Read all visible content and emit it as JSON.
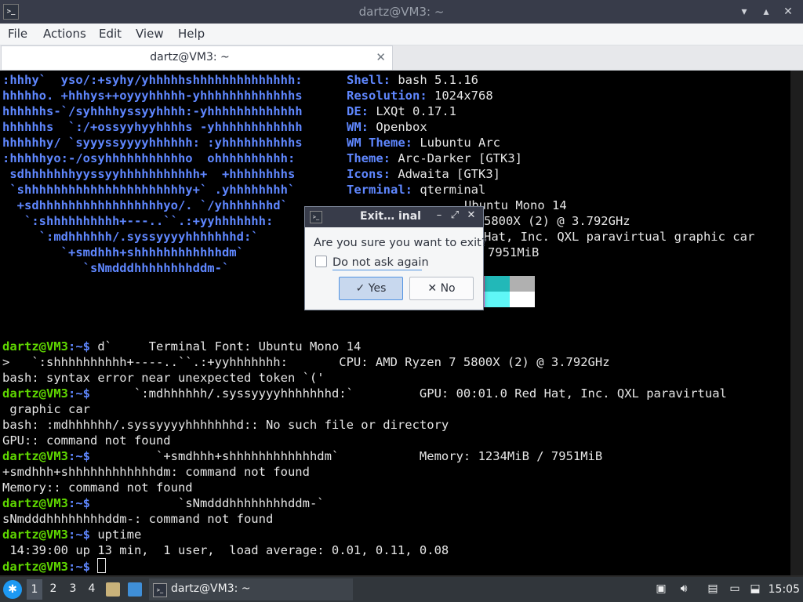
{
  "window": {
    "title": "dartz@VM3: ~",
    "app_icon_glyph": ">_",
    "buttons": {
      "minimize": "▾",
      "maximize": "▴",
      "close": "✕"
    }
  },
  "menubar": {
    "items": [
      "File",
      "Actions",
      "Edit",
      "View",
      "Help"
    ]
  },
  "tab": {
    "title": "dartz@VM3: ~",
    "close": "✕"
  },
  "terminal": {
    "logo_lines": [
      ":hhhy`  yso/:+syhy/yhhhhhshhhhhhhhhhhhhh:",
      "hhhhho. +hhhys++oyyyhhhhh-yhhhhhhhhhhhhhs",
      "hhhhhhs-`/syhhhhyssyyhhhh:-yhhhhhhhhhhhhh",
      "hhhhhhs  `:/+ossyyhyyhhhhs -yhhhhhhhhhhhh",
      "hhhhhhy/ `syyyssyyyyhhhhhh: :yhhhhhhhhhhs",
      ":hhhhhyo:-/osyhhhhhhhhhhho  ohhhhhhhhhh:",
      " sdhhhhhhhyyssyyhhhhhhhhhhh+  +hhhhhhhhs",
      " `shhhhhhhhhhhhhhhhhhhhhhy+` .yhhhhhhhh`",
      "  +sdhhhhhhhhhhhhhhhhhyo/. `/yhhhhhhhd`",
      "   `:shhhhhhhhhh+---..``.:+yyhhhhhhh:",
      "     `:mdhhhhhh/.syssyyyyhhhhhhhd:`",
      "        `+smdhhh+shhhhhhhhhhhhdm`",
      "           `sNmdddhhhhhhhhddm-`"
    ],
    "info": [
      {
        "key": "Shell",
        "value": " bash 5.1.16"
      },
      {
        "key": "Resolution",
        "value": " 1024x768"
      },
      {
        "key": "DE",
        "value": " LXQt 0.17.1"
      },
      {
        "key": "WM",
        "value": " Openbox"
      },
      {
        "key": "WM Theme",
        "value": " Lubuntu Arc"
      },
      {
        "key": "Theme",
        "value": " Arc-Darker [GTK3]"
      },
      {
        "key": "Icons",
        "value": " Adwaita [GTK3]"
      },
      {
        "key": "Terminal",
        "value": " qterminal"
      }
    ],
    "partial": [
      {
        "prefix": "",
        "text": "Ubuntu Mono 14"
      },
      {
        "prefix": "",
        "text": "5800X (2) @ 3.792GHz"
      },
      {
        "prefix": "",
        "text": "Hat, Inc. QXL paravirtual graphic car"
      },
      {
        "prefix": "",
        "text": "7951MiB"
      }
    ],
    "prompt": "dartz@VM3",
    "prompt_tail": ":~$",
    "session": [
      {
        "type": "cmd",
        "text": " d`     Terminal Font: Ubuntu Mono 14"
      },
      {
        "type": "out",
        "text": ">   `:shhhhhhhhhh+----..``.:+yyhhhhhhh:       CPU: AMD Ryzen 7 5800X (2) @ 3.792GHz"
      },
      {
        "type": "out",
        "text": "bash: syntax error near unexpected token `('"
      },
      {
        "type": "cmd",
        "text": "      `:mdhhhhhh/.syssyyyyhhhhhhhd:`         GPU: 00:01.0 Red Hat, Inc. QXL paravirtual"
      },
      {
        "type": "out",
        "text": " graphic car"
      },
      {
        "type": "out",
        "text": "bash: :mdhhhhhh/.syssyyyyhhhhhhhd:: No such file or directory"
      },
      {
        "type": "out",
        "text": "GPU:: command not found"
      },
      {
        "type": "cmd",
        "text": "         `+smdhhh+shhhhhhhhhhhhdm`           Memory: 1234MiB / 7951MiB"
      },
      {
        "type": "out",
        "text": "+smdhhh+shhhhhhhhhhhhdm: command not found"
      },
      {
        "type": "out",
        "text": "Memory:: command not found"
      },
      {
        "type": "cmd",
        "text": "            `sNmdddhhhhhhhhddm-`"
      },
      {
        "type": "out",
        "text": "sNmdddhhhhhhhhddm-: command not found"
      },
      {
        "type": "cmd",
        "text": " uptime"
      },
      {
        "type": "out",
        "text": " 14:39:00 up 13 min,  1 user,  load average: 0.01, 0.11, 0.08"
      },
      {
        "type": "cmd",
        "text": " "
      }
    ],
    "colors": {
      "logo": "#5f87ff",
      "prompt": "#5fd700",
      "swatches_top": [
        "#e94f9b",
        "#22b8b8",
        "#b0b0b0"
      ],
      "swatches_bottom": [
        "#ff6ae8",
        "#5ff6f6",
        "#ffffff"
      ]
    }
  },
  "dialog": {
    "title": "Exit… inal",
    "message": "Are you sure you want to exit?",
    "checkbox_label": "Do not ask again",
    "yes": "✓ Yes",
    "no": "✕  No",
    "buttons": {
      "minimize": "–",
      "maximize": "⤢",
      "close": "✕"
    }
  },
  "taskbar": {
    "workspaces": [
      "1",
      "2",
      "3",
      "4"
    ],
    "task_title": "dartz@VM3: ~",
    "clock": "15:05",
    "colors": {
      "accent": "#1d99f3"
    }
  }
}
